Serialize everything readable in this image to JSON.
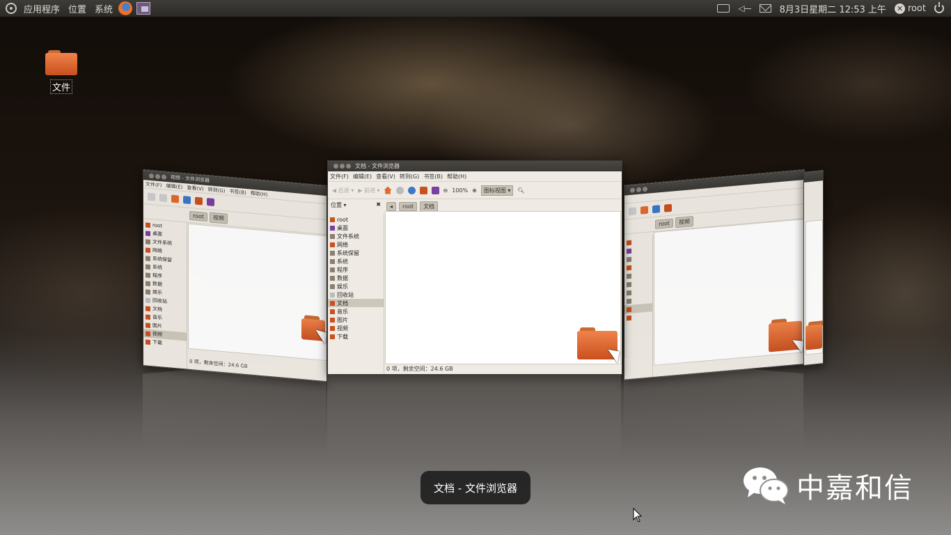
{
  "panel": {
    "menus": [
      "应用程序",
      "位置",
      "系统"
    ],
    "clock": "8月3日星期二 12:53 上午",
    "user": "root",
    "volume": "◁---"
  },
  "desktop": {
    "icon_label": "文件"
  },
  "main_window": {
    "title": "文档 - 文件浏览器",
    "menus": [
      "文件(F)",
      "编辑(E)",
      "查看(V)",
      "转到(G)",
      "书签(B)",
      "帮助(H)"
    ],
    "back_label": "后退",
    "forward_label": "前进",
    "zoom": "100%",
    "view_mode": "图标视图",
    "places_header": "位置",
    "places_close": "✖",
    "breadcrumbs": [
      "root",
      "文档"
    ],
    "places": [
      {
        "label": "root",
        "color": "#c9501f"
      },
      {
        "label": "桌面",
        "color": "#7a3fa0"
      },
      {
        "label": "文件系统",
        "color": "#888"
      },
      {
        "label": "网络",
        "color": "#c9501f"
      },
      {
        "label": "系统保留",
        "color": "#888"
      },
      {
        "label": "系统",
        "color": "#888"
      },
      {
        "label": "程序",
        "color": "#888"
      },
      {
        "label": "数据",
        "color": "#888"
      },
      {
        "label": "娱乐",
        "color": "#888"
      },
      {
        "label": "回收站",
        "color": "#bbb"
      },
      {
        "label": "文档",
        "color": "#c9501f",
        "active": true
      },
      {
        "label": "音乐",
        "color": "#c9501f"
      },
      {
        "label": "图片",
        "color": "#c9501f"
      },
      {
        "label": "视频",
        "color": "#c9501f"
      },
      {
        "label": "下载",
        "color": "#c9501f"
      }
    ],
    "status": "0 项，剩余空间：24.6 GB"
  },
  "left_window": {
    "title": "视频 - 文件浏览器",
    "menus": [
      "文件(F)",
      "编辑(E)",
      "查看(V)",
      "转到(G)",
      "书签(B)",
      "帮助(H)"
    ],
    "breadcrumbs": [
      "root",
      "视频"
    ],
    "status": "0 项，剩余空间：24.6 GB"
  },
  "right_window": {
    "breadcrumbs": [
      "root",
      "视频"
    ]
  },
  "switcher": {
    "label": "文档 - 文件浏览器"
  },
  "watermark": {
    "text": "中嘉和信"
  },
  "colors": {
    "accent": "#e8732a",
    "panel": "#3a3835",
    "window_bg": "#efebe4"
  }
}
